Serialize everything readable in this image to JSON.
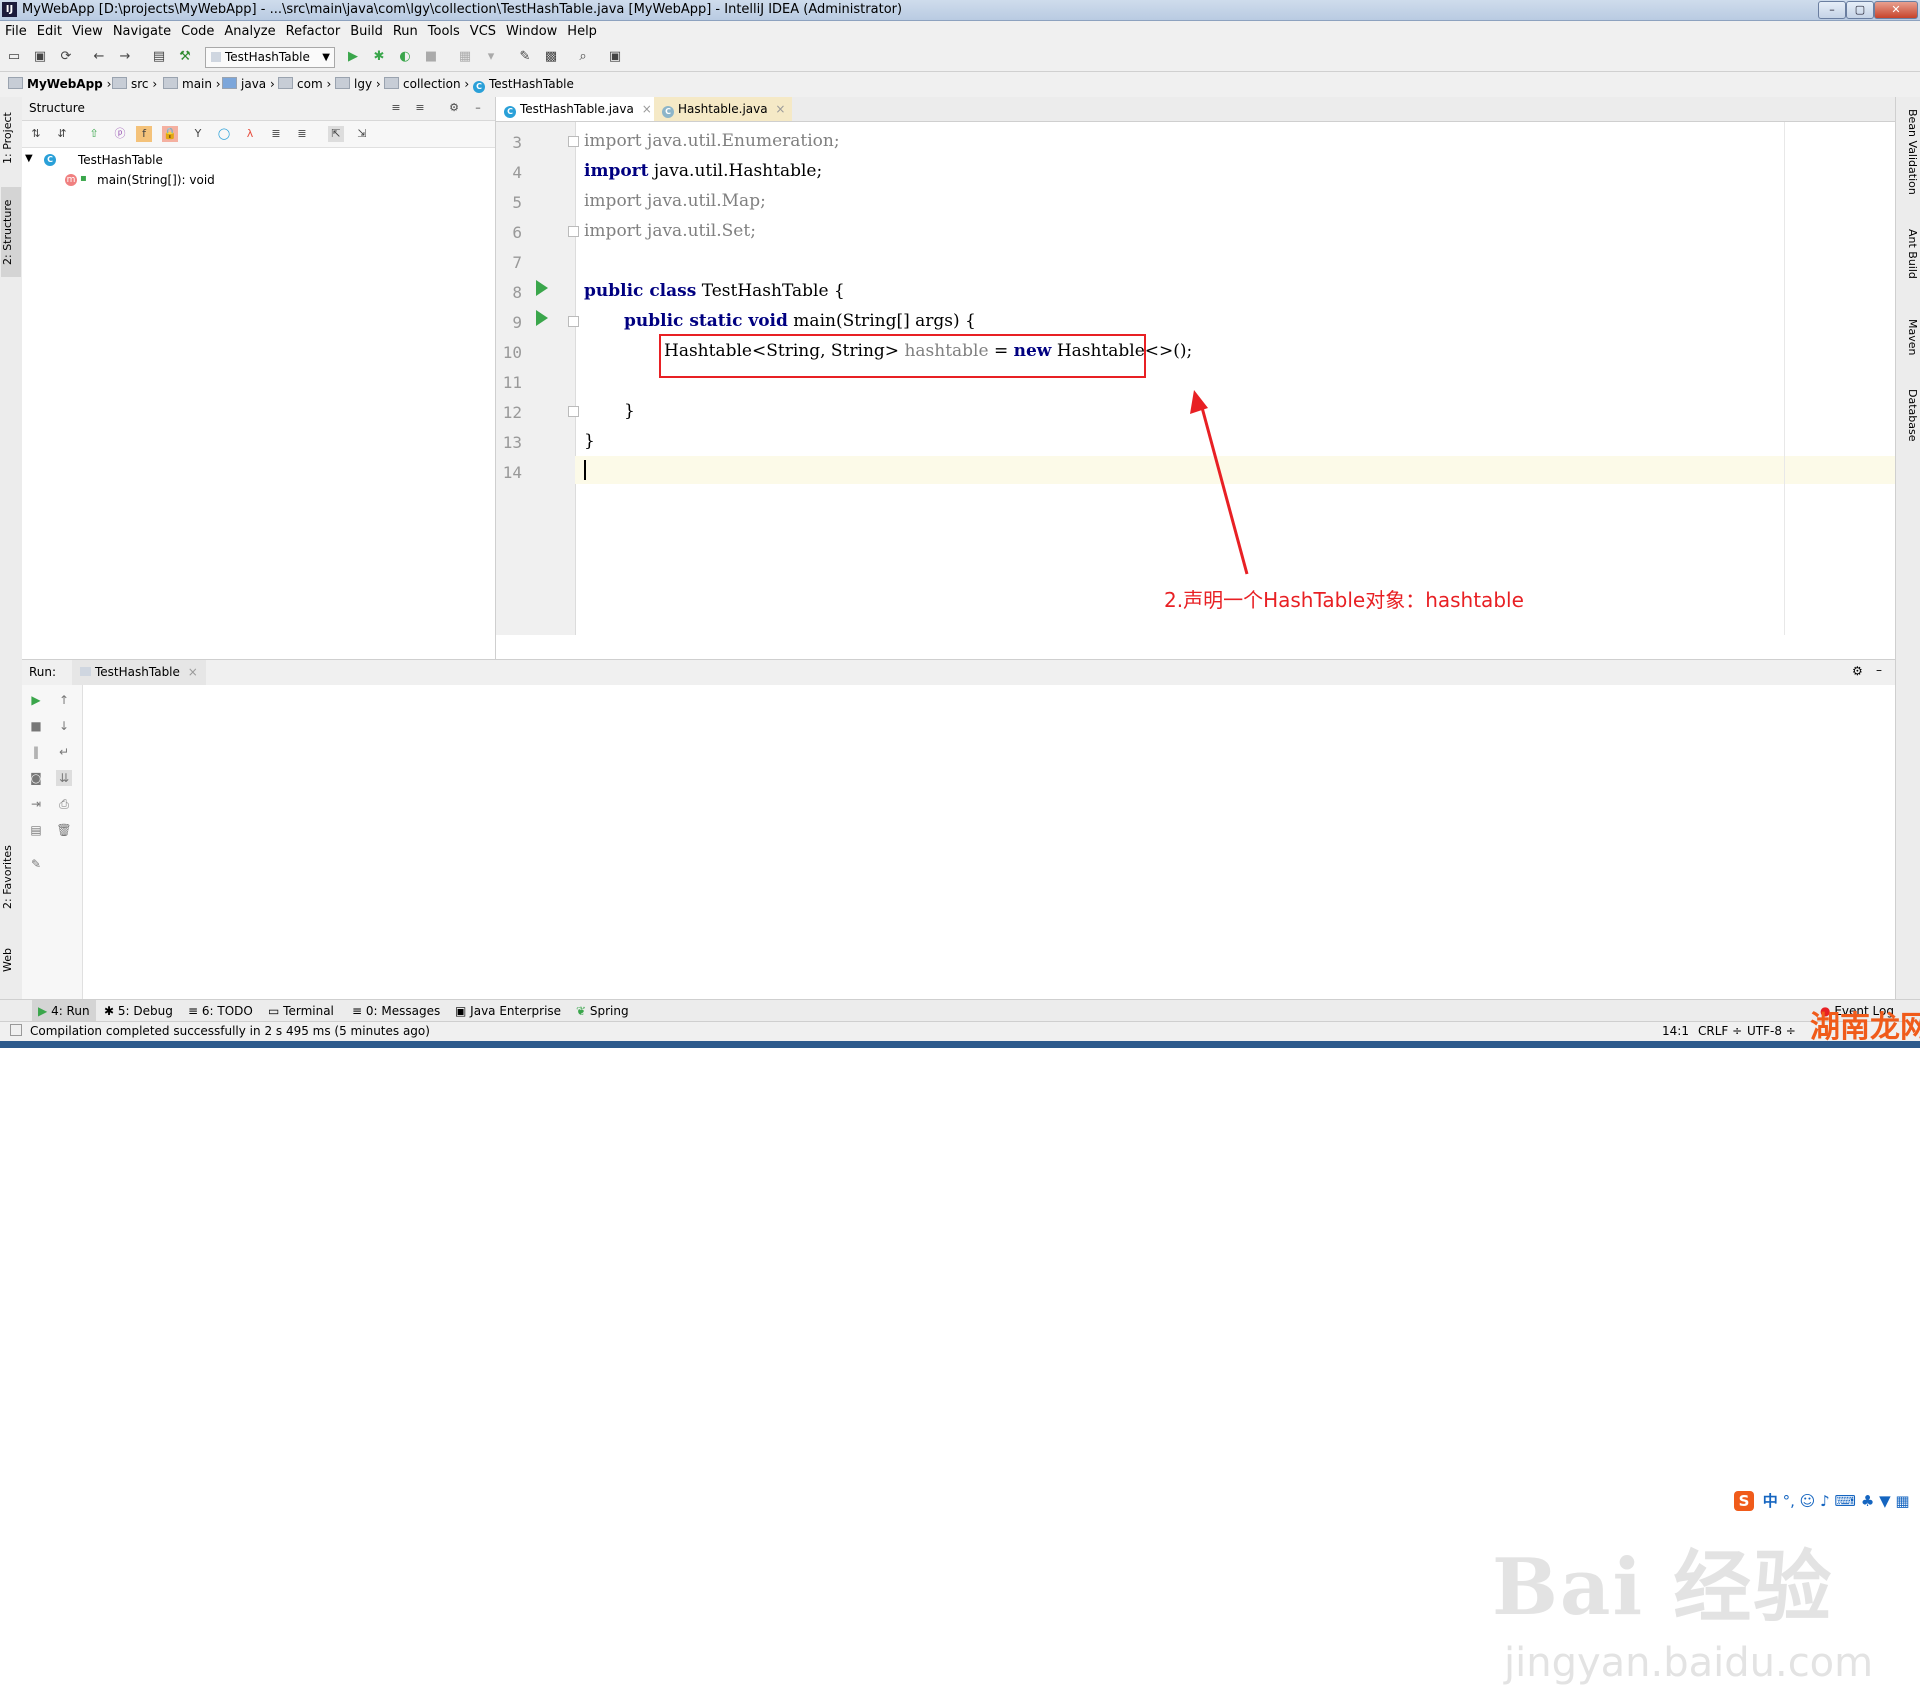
{
  "window": {
    "title": "MyWebApp [D:\\projects\\MyWebApp] - ...\\src\\main\\java\\com\\lgy\\collection\\TestHashTable.java [MyWebApp] - IntelliJ IDEA (Administrator)",
    "app_icon_label": "IJ"
  },
  "menu": [
    "File",
    "Edit",
    "View",
    "Navigate",
    "Code",
    "Analyze",
    "Refactor",
    "Build",
    "Run",
    "Tools",
    "VCS",
    "Window",
    "Help"
  ],
  "toolbar": {
    "run_config": "TestHashTable"
  },
  "breadcrumbs": [
    "MyWebApp",
    "src",
    "main",
    "java",
    "com",
    "lgy",
    "collection",
    "TestHashTable"
  ],
  "left_tabs": {
    "project": "1: Project",
    "structure": "2: Structure",
    "favorites": "2: Favorites",
    "web": "Web"
  },
  "right_tabs": {
    "bean_validation": "Bean Validation",
    "ant_build": "Ant Build",
    "maven": "Maven",
    "database": "Database"
  },
  "structure": {
    "title": "Structure",
    "tree": [
      {
        "label": "TestHashTable",
        "icon_letter": "C"
      },
      {
        "label": "main(String[]): void",
        "icon_letter": "m"
      }
    ]
  },
  "editor": {
    "tabs": [
      {
        "label": "TestHashTable.java",
        "active": true
      },
      {
        "label": "Hashtable.java",
        "active": false
      }
    ],
    "line_numbers": [
      "3",
      "4",
      "5",
      "6",
      "7",
      "8",
      "9",
      "10",
      "11",
      "12",
      "13",
      "14"
    ],
    "code": {
      "l3_kw": "import",
      "l3_rest": " java.util.Enumeration;",
      "l4_kw": "import",
      "l4_rest": " java.util.Hashtable;",
      "l5_kw": "import",
      "l5_rest": " java.util.Map;",
      "l6_kw": "import",
      "l6_rest": " java.util.Set;",
      "l8_kw": "public class",
      "l8_rest": " TestHashTable {",
      "l9_kw": "public static void",
      "l9_rest": " main(String[] args) {",
      "l10_a": "Hashtable<String, String> ",
      "l10_var": "hashtable",
      "l10_b": " = ",
      "l10_kw": "new",
      "l10_c": " Hashtable<>();",
      "l12": "}",
      "l13": "}"
    },
    "annotation": "2.声明一个HashTable对象：hashtable"
  },
  "run_panel": {
    "label": "Run:",
    "tab": "TestHashTable"
  },
  "bottom_tools": [
    "4: Run",
    "5: Debug",
    "6: TODO",
    "Terminal",
    "0: Messages",
    "Java Enterprise",
    "Spring"
  ],
  "event_log": "Event Log",
  "status": {
    "message": "Compilation completed successfully in 2 s 495 ms (5 minutes ago)",
    "position": "14:1",
    "line_sep": "CRLF ÷",
    "encoding": "UTF-8 ÷"
  },
  "ime": {
    "logo": "S",
    "lang": "中"
  },
  "watermark": {
    "main": "Bai 经验",
    "sub": "jingyan.baidu.com",
    "corner": "湖南龙网"
  }
}
